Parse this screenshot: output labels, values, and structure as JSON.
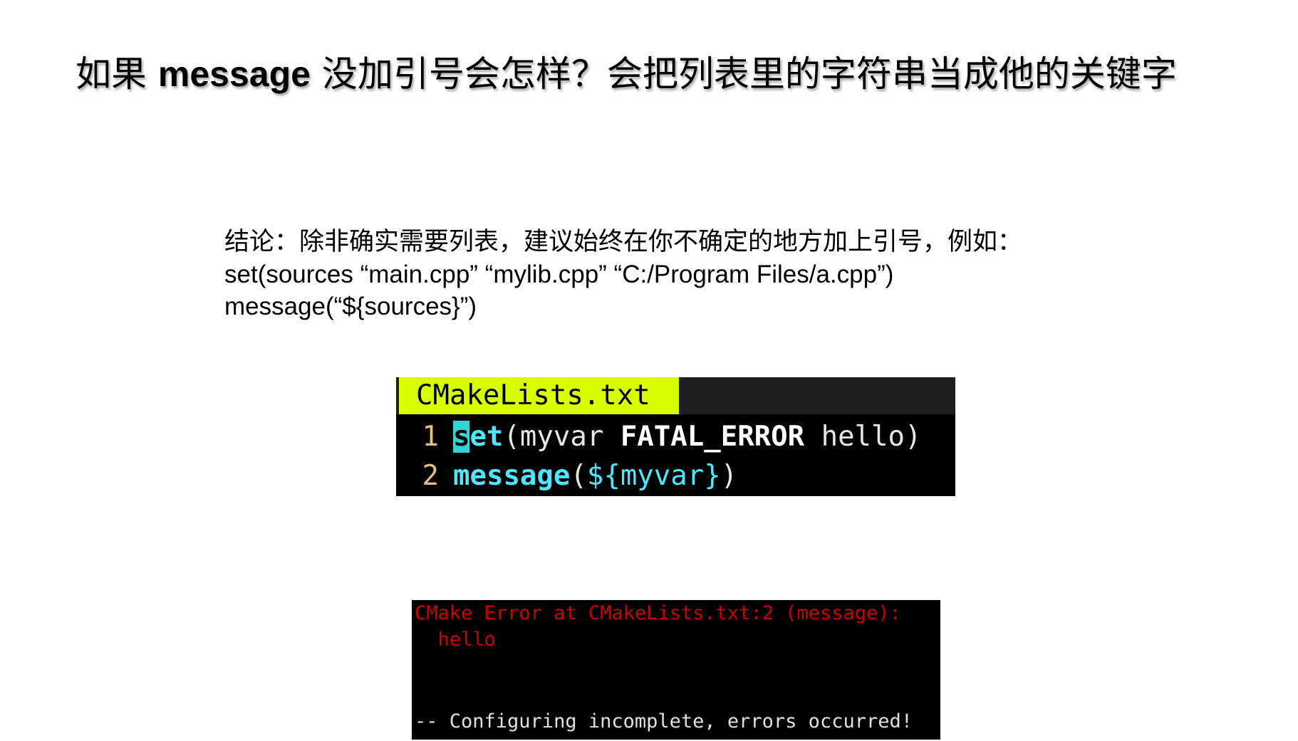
{
  "slide": {
    "title_pre": "如果 ",
    "title_keyword": "message",
    "title_post": " 没加引号会怎样？会把列表里的字符串当成他的关键字",
    "conclusion": "结论：除非确实需要列表，建议始终在你不确定的地方加上引号，例如：",
    "example_line_1": "set(sources “main.cpp” “mylib.cpp” “C:/Program Files/a.cpp”)",
    "example_line_2": "message(“${sources}”)"
  },
  "editor": {
    "tab_label": "CMakeLists.txt",
    "lines": [
      {
        "number": "1",
        "cursor_char": "s",
        "fn_rest": "et",
        "open": "(myvar ",
        "strong": "FATAL_ERROR",
        "rest": " hello)"
      },
      {
        "number": "2",
        "fn": "message",
        "open": "(",
        "var": "${myvar}",
        "close": ")"
      }
    ],
    "colors": {
      "tab_bg": "#d7ff00",
      "function": "#4ee6ff",
      "line_number": "#e5c07b",
      "cursor": "#32d4d4"
    }
  },
  "terminal": {
    "error_line": "CMake Error at CMakeLists.txt:2 (message):",
    "error_detail": "  hello",
    "status_line": "-- Configuring incomplete, errors occurred!",
    "colors": {
      "error": "#cc0000",
      "text": "#e0e0e0"
    }
  }
}
